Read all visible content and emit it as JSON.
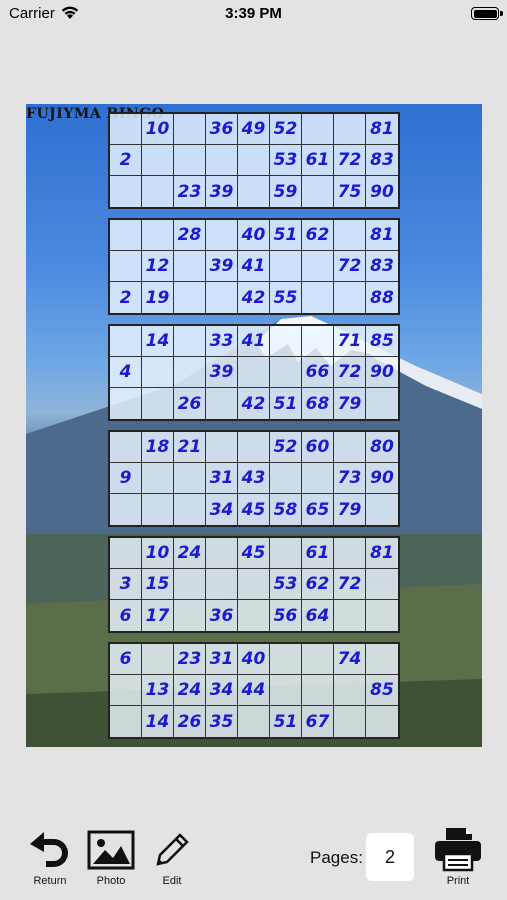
{
  "status_bar": {
    "carrier": "Carrier",
    "time": "3:39 PM"
  },
  "sheet": {
    "title": "FUJIYMA BINGO",
    "cards": [
      {
        "rows": [
          [
            "",
            "10",
            "",
            "36",
            "49",
            "52",
            "",
            "",
            "81"
          ],
          [
            "2",
            "",
            "",
            "",
            "",
            "53",
            "61",
            "72",
            "83"
          ],
          [
            "",
            "",
            "23",
            "39",
            "",
            "59",
            "",
            "75",
            "90"
          ]
        ]
      },
      {
        "rows": [
          [
            "",
            "",
            "28",
            "",
            "40",
            "51",
            "62",
            "",
            "81"
          ],
          [
            "",
            "12",
            "",
            "39",
            "41",
            "",
            "",
            "72",
            "83"
          ],
          [
            "2",
            "19",
            "",
            "",
            "42",
            "55",
            "",
            "",
            "88"
          ]
        ]
      },
      {
        "rows": [
          [
            "",
            "14",
            "",
            "33",
            "41",
            "",
            "",
            "71",
            "85"
          ],
          [
            "4",
            "",
            "",
            "39",
            "",
            "",
            "66",
            "72",
            "90"
          ],
          [
            "",
            "",
            "26",
            "",
            "42",
            "51",
            "68",
            "79",
            ""
          ]
        ]
      },
      {
        "rows": [
          [
            "",
            "18",
            "21",
            "",
            "",
            "52",
            "60",
            "",
            "80"
          ],
          [
            "9",
            "",
            "",
            "31",
            "43",
            "",
            "",
            "73",
            "90"
          ],
          [
            "",
            "",
            "",
            "34",
            "45",
            "58",
            "65",
            "79",
            ""
          ]
        ]
      },
      {
        "rows": [
          [
            "",
            "10",
            "24",
            "",
            "45",
            "",
            "61",
            "",
            "81"
          ],
          [
            "3",
            "15",
            "",
            "",
            "",
            "53",
            "62",
            "72",
            ""
          ],
          [
            "6",
            "17",
            "",
            "36",
            "",
            "56",
            "64",
            "",
            ""
          ]
        ]
      },
      {
        "rows": [
          [
            "6",
            "",
            "23",
            "31",
            "40",
            "",
            "",
            "74",
            ""
          ],
          [
            "",
            "13",
            "24",
            "34",
            "44",
            "",
            "",
            "",
            "85"
          ],
          [
            "",
            "14",
            "26",
            "35",
            "",
            "51",
            "67",
            "",
            ""
          ]
        ]
      }
    ]
  },
  "toolbar": {
    "return_label": "Return",
    "photo_label": "Photo",
    "edit_label": "Edit",
    "pages_label": "Pages:",
    "pages_value": "2",
    "print_label": "Print"
  }
}
